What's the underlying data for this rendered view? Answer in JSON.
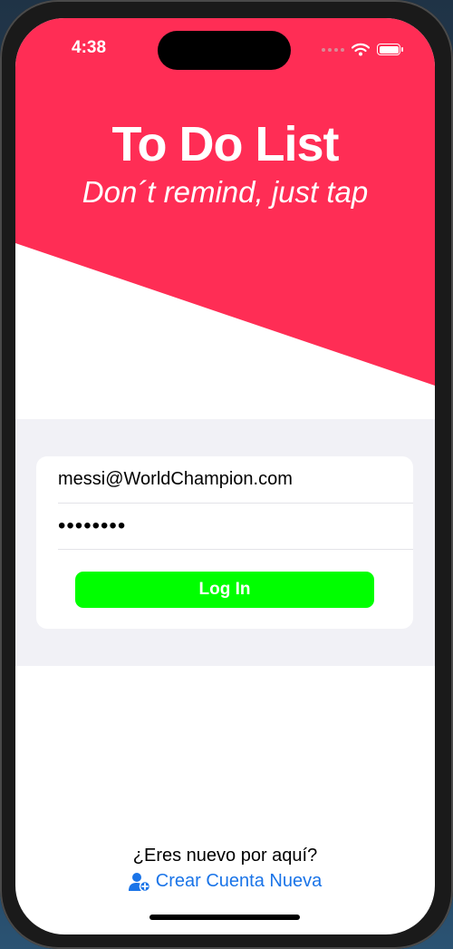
{
  "status_bar": {
    "time": "4:38"
  },
  "header": {
    "title": "To Do List",
    "subtitle": "Don´t remind, just tap",
    "accent_color": "#ff2d55"
  },
  "login_form": {
    "email_value": "messi@WorldChampion.com",
    "password_value": "••••••••",
    "login_label": "Log In",
    "login_button_color": "#00ff00"
  },
  "footer": {
    "question": "¿Eres nuevo por aquí?",
    "create_account_label": "Crear Cuenta Nueva",
    "create_account_icon": "person-add-icon",
    "link_color": "#1a74e8"
  }
}
